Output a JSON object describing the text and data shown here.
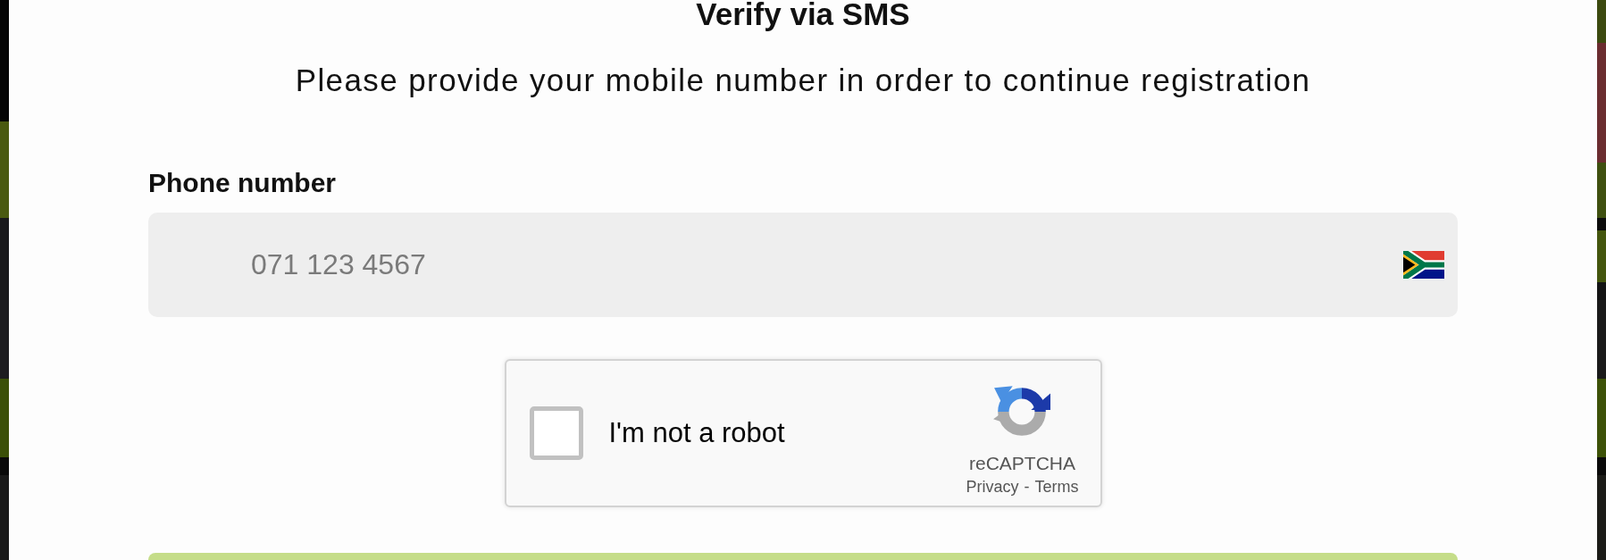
{
  "dialog": {
    "title": "Verify via SMS",
    "subtitle": "Please provide your mobile number in order to continue registration"
  },
  "phone_field": {
    "label": "Phone number",
    "placeholder": "071 123 4567"
  },
  "captcha": {
    "checked": false,
    "label": "I'm not a robot",
    "brand": "reCAPTCHA",
    "links": [
      "Privacy",
      "Terms"
    ],
    "separator": "-"
  }
}
